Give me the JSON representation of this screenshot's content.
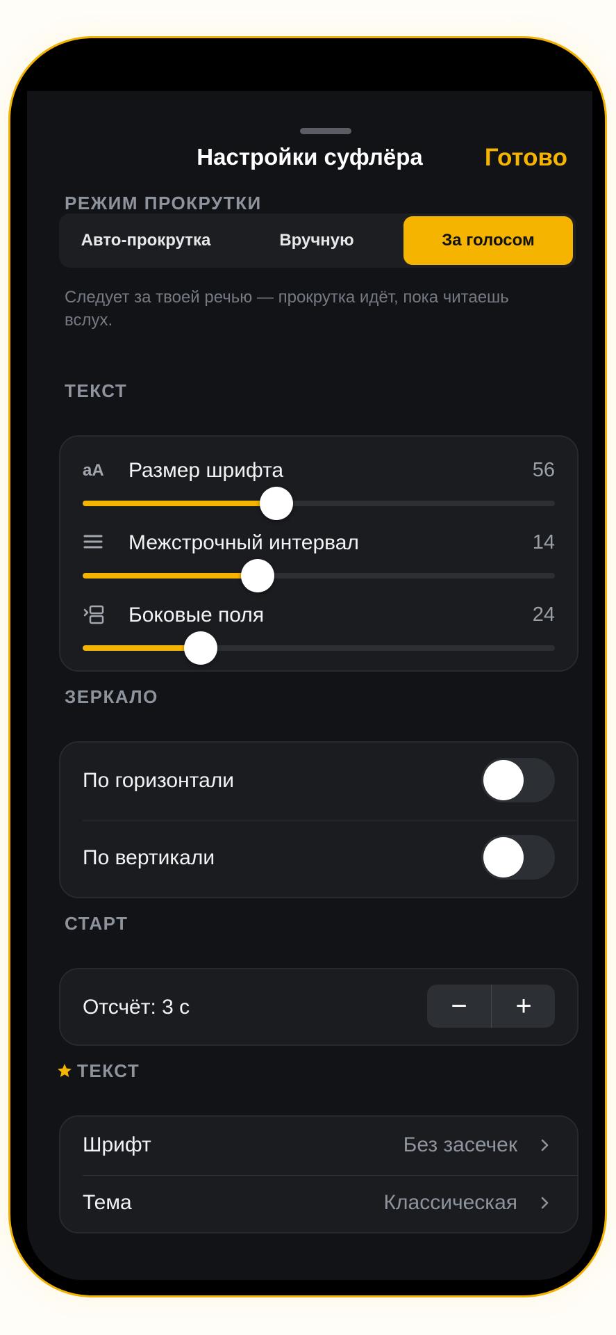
{
  "header": {
    "title": "Настройки суфлёра",
    "done_label": "Готово"
  },
  "scroll_mode": {
    "section_label": "РЕЖИМ ПРОКРУТКИ",
    "options": [
      "Авто-прокрутка",
      "Вручную",
      "За голосом"
    ],
    "selected": "За голосом",
    "hint": "Следует за твоей речью — прокрутка идёт, пока читаешь вслух."
  },
  "text": {
    "section_label": "ТЕКСТ",
    "font_size": {
      "icon": "aA",
      "label": "Размер шрифта",
      "value": "56",
      "fill_fraction": 0.41
    },
    "line_spacing": {
      "icon": "lines-icon",
      "label": "Межстрочный интервал",
      "value": "14",
      "fill_fraction": 0.37
    },
    "margins": {
      "icon": "margins-icon",
      "label": "Боковые поля",
      "value": "24",
      "fill_fraction": 0.25
    }
  },
  "mirror": {
    "section_label": "ЗЕРКАЛО",
    "horizontal": {
      "label": "По горизонтали",
      "on": false
    },
    "vertical": {
      "label": "По вертикали",
      "on": false
    }
  },
  "start": {
    "section_label": "СТАРТ",
    "countdown_label": "Отсчёт: 3 с",
    "minus": "−",
    "plus": "+"
  },
  "extra_text": {
    "section_label": "ТЕКСТ",
    "font": {
      "label": "Шрифт",
      "value": "Без засечек"
    },
    "theme": {
      "label": "Тема",
      "value": "Классическая"
    }
  },
  "colors": {
    "accent": "#f4b400",
    "background": "#121316",
    "card": "#1a1c20"
  }
}
